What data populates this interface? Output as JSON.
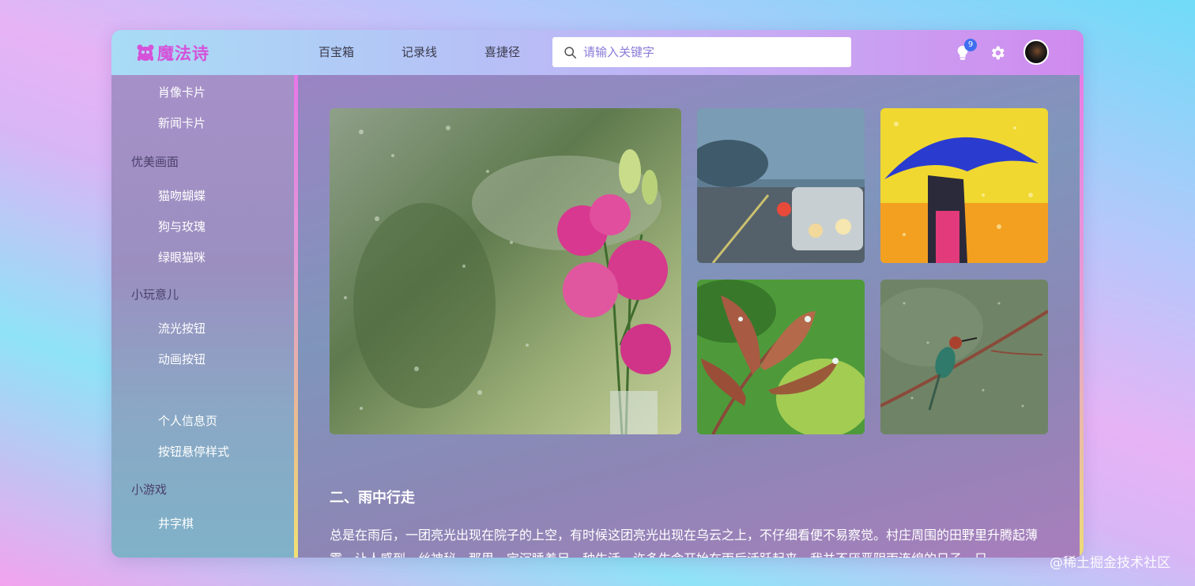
{
  "header": {
    "logo_text": "魔法诗",
    "nav": [
      "百宝箱",
      "记录线",
      "喜捷径"
    ],
    "search_placeholder": "请输入关键字",
    "notification_count": "9",
    "colors": {
      "logo": "#d552d9",
      "badge": "#3f6ef0",
      "search_placeholder": "#8a7bd8"
    }
  },
  "sidebar": {
    "items": [
      {
        "type": "item",
        "label": "肖像卡片"
      },
      {
        "type": "item",
        "label": "新闻卡片"
      },
      {
        "type": "group",
        "label": "优美画面"
      },
      {
        "type": "item",
        "label": "猫吻蝴蝶"
      },
      {
        "type": "item",
        "label": "狗与玫瑰"
      },
      {
        "type": "item",
        "label": "绿眼猫咪"
      },
      {
        "type": "group",
        "label": "小玩意儿"
      },
      {
        "type": "item",
        "label": "流光按钮"
      },
      {
        "type": "item",
        "label": "动画按钮"
      },
      {
        "type": "item",
        "label": "",
        "active": true
      },
      {
        "type": "item",
        "label": "个人信息页"
      },
      {
        "type": "item",
        "label": "按钮悬停样式"
      },
      {
        "type": "group",
        "label": "小游戏"
      },
      {
        "type": "item",
        "label": "井字棋"
      }
    ]
  },
  "main": {
    "images": [
      {
        "name": "rainy-window-flowers-image",
        "icon": "pink-roses-behind-wet-glass"
      },
      {
        "name": "rainy-street-cars-image",
        "icon": "car-headlights-in-rain"
      },
      {
        "name": "umbrella-rain-image",
        "icon": "blue-umbrella-yellow-background"
      },
      {
        "name": "wet-leaves-image",
        "icon": "leaves-with-raindrops"
      },
      {
        "name": "bird-on-branch-image",
        "icon": "bird-perched-in-rain"
      }
    ],
    "section_title": "二、雨中行走",
    "paragraph": "总是在雨后，一团亮光出现在院子的上空，有时候这团亮光出现在乌云之上，不仔细看便不易察觉。村庄周围的田野里升腾起薄雾，让人感到一丝神秘，那里一定沉睡着另一种生活，许多生命开始在雨后活跃起来。我并不厌恶阴雨连绵的日子，只"
  },
  "watermark": "@稀土掘金技术社区"
}
